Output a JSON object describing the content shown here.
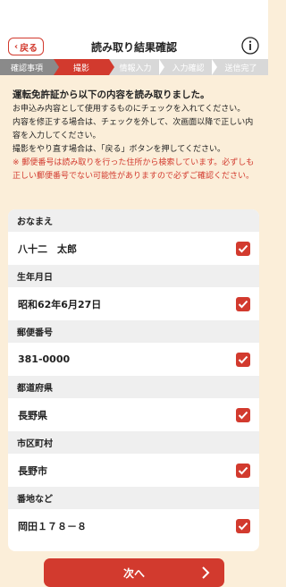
{
  "header": {
    "title": "読み取り結果確認",
    "back_label": "戻る"
  },
  "steps": [
    {
      "label": "確認事項",
      "state": "done"
    },
    {
      "label": "撮影",
      "state": "active"
    },
    {
      "label": "情報入力",
      "state": "pending"
    },
    {
      "label": "入力確認",
      "state": "pending"
    },
    {
      "label": "送信完了",
      "state": "pending"
    }
  ],
  "intro": {
    "lead": "運転免許証から以下の内容を読み取りました。",
    "line1": "お申込み内容として使用するものにチェックを入れてください。",
    "line2": "内容を修正する場合は、チェックを外して、次画面以降で正しい内容を入力してください。",
    "line3": "撮影をやり直す場合は、「戻る」ボタンを押してください。",
    "note": "※ 郵便番号は読み取りを行った住所から検索しています。必ずしも正しい郵便番号でない可能性がありますので必ずご確認ください。"
  },
  "fields": [
    {
      "label": "おなまえ",
      "value": "八十二　太郎",
      "checked": true
    },
    {
      "label": "生年月日",
      "value": "昭和62年6月27日",
      "checked": true
    },
    {
      "label": "郵便番号",
      "value": "381-0000",
      "checked": true
    },
    {
      "label": "都道府県",
      "value": "長野県",
      "checked": true
    },
    {
      "label": "市区町村",
      "value": "長野市",
      "checked": true
    },
    {
      "label": "番地など",
      "value": "岡田１７８－８",
      "checked": true
    }
  ],
  "next_label": "次へ",
  "colors": {
    "accent": "#d23a2e",
    "background": "#fbeed9"
  }
}
